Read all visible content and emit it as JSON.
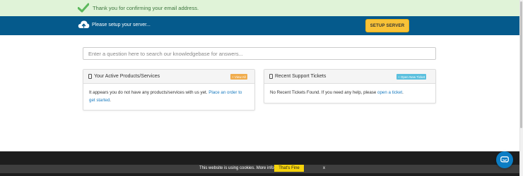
{
  "alert": {
    "message": "Thank you for confirming your email address.",
    "icon": "check-icon"
  },
  "setup": {
    "message": "Please setup your server...",
    "button_label": "SETUP SERVER",
    "icon": "cloud-upload-icon"
  },
  "search": {
    "placeholder": "Enter a question here to search our knowledgebase for answers..."
  },
  "products_panel": {
    "title": "Your Active Products/Services",
    "badge": "View All",
    "body_text": "It appears you do not have any products/services with us yet.",
    "link_text": "Place an order to get started",
    "body_end": "."
  },
  "tickets_panel": {
    "title": "Recent Support Tickets",
    "badge": "Open New Ticket",
    "body_text": "No Recent Tickets Found. If you need any help, please",
    "link_text": "open a ticket",
    "body_end": "."
  },
  "cookie": {
    "message": "This website is using cookies.",
    "more_info": "More info.",
    "accept_label": "That's Fine",
    "close_label": "x"
  },
  "colors": {
    "success_bg": "#e0f3d8",
    "setup_bg": "#055a8c",
    "setup_button": "#f8c237",
    "link": "#1a7bbf",
    "view_all_badge": "#f0ad4e",
    "new_ticket_badge": "#5bc0de",
    "cookie_button": "#f6d30b",
    "chat": "#0b7dc4"
  }
}
